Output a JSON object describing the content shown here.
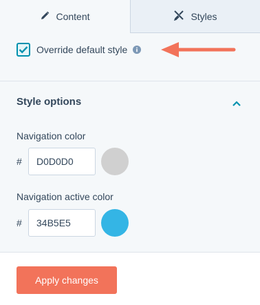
{
  "tabs": [
    {
      "label": "Content",
      "icon": "pencil-icon",
      "active": true
    },
    {
      "label": "Styles",
      "icon": "brush-icon",
      "active": false
    }
  ],
  "override": {
    "label": "Override default style",
    "checked": true,
    "info_icon": "info-icon"
  },
  "annotation": {
    "icon": "arrow-left-icon",
    "color": "#f2735a"
  },
  "style_options": {
    "title": "Style options",
    "collapse_icon": "chevron-up-icon",
    "fields": [
      {
        "label": "Navigation color",
        "prefix": "#",
        "value": "D0D0D0",
        "swatch": "#D0D0D0"
      },
      {
        "label": "Navigation active color",
        "prefix": "#",
        "value": "34B5E5",
        "swatch": "#34B5E5"
      }
    ]
  },
  "footer": {
    "apply_label": "Apply changes"
  },
  "colors": {
    "accent": "#f2735a",
    "teal": "#0091ae",
    "text": "#33475b",
    "panel": "#f5f8fa"
  }
}
